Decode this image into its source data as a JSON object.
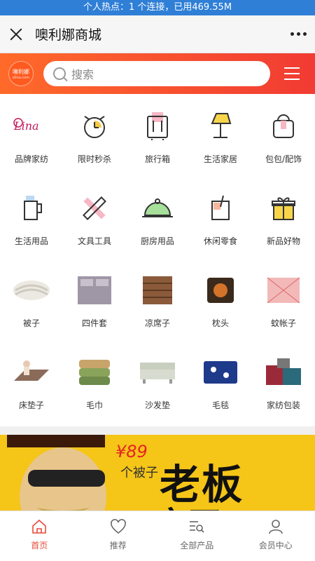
{
  "status": {
    "hotspot_text": "个人热点：1 个连接，已用469.55M"
  },
  "titlebar": {
    "title": "噢利娜商城",
    "close_icon": "close-icon",
    "more_icon": "more-icon"
  },
  "header": {
    "logo_text": "噢利娜",
    "logo_sub": "olina.com",
    "search_placeholder": "搜索",
    "brand_color": "#f13b33"
  },
  "categories": [
    {
      "label": "品牌家纺",
      "icon": "brand-logo-icon"
    },
    {
      "label": "限时秒杀",
      "icon": "alarm-clock-icon"
    },
    {
      "label": "旅行箱",
      "icon": "suitcase-icon"
    },
    {
      "label": "生活家居",
      "icon": "lamp-icon"
    },
    {
      "label": "包包/配饰",
      "icon": "bag-icon"
    },
    {
      "label": "生活用品",
      "icon": "jug-icon"
    },
    {
      "label": "文具工具",
      "icon": "ruler-pencil-icon"
    },
    {
      "label": "厨房用品",
      "icon": "cloche-icon"
    },
    {
      "label": "休闲零食",
      "icon": "drink-icon"
    },
    {
      "label": "新品好物",
      "icon": "gift-icon"
    },
    {
      "label": "被子",
      "icon": "quilt-image"
    },
    {
      "label": "四件套",
      "icon": "bedding-set-image"
    },
    {
      "label": "凉席子",
      "icon": "mat-image"
    },
    {
      "label": "枕头",
      "icon": "pillow-image"
    },
    {
      "label": "蚊帐子",
      "icon": "mosquito-net-image"
    },
    {
      "label": "床垫子",
      "icon": "mattress-image"
    },
    {
      "label": "毛巾",
      "icon": "towel-image"
    },
    {
      "label": "沙发垫",
      "icon": "sofa-image"
    },
    {
      "label": "毛毯",
      "icon": "blanket-image"
    },
    {
      "label": "家纺包装",
      "icon": "packaging-image"
    }
  ],
  "banner": {
    "price": "¥89",
    "small": "个被子",
    "big": "老板",
    "sub": "疯了!"
  },
  "tabs": [
    {
      "label": "首页",
      "icon": "home-icon",
      "active": true
    },
    {
      "label": "推荐",
      "icon": "heart-icon",
      "active": false
    },
    {
      "label": "全部产品",
      "icon": "list-search-icon",
      "active": false
    },
    {
      "label": "会员中心",
      "icon": "user-icon",
      "active": false
    }
  ]
}
